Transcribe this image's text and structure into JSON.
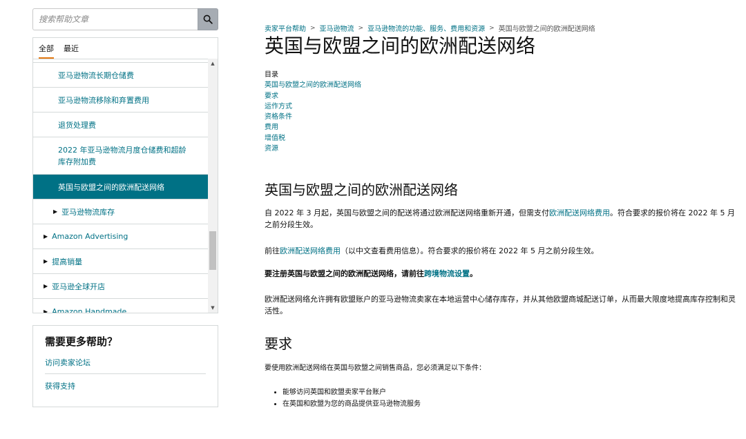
{
  "sidebar": {
    "search_placeholder": "搜索帮助文章",
    "tabs": [
      {
        "label": "全部",
        "active": true
      },
      {
        "label": "最近",
        "active": false
      }
    ],
    "nav_items": [
      {
        "label": "亚马逊物流长期仓储费",
        "level": 2,
        "selected": false
      },
      {
        "label": "亚马逊物流移除和弃置费用",
        "level": 2,
        "selected": false
      },
      {
        "label": "退货处理费",
        "level": 2,
        "selected": false
      },
      {
        "label": "2022 年亚马逊物流月度仓储费和超龄库存附加费",
        "level": 2,
        "selected": false
      },
      {
        "label": "英国与欧盟之间的欧洲配送网络",
        "level": 2,
        "selected": true
      },
      {
        "label": "亚马逊物流库存",
        "level": 2,
        "selected": false,
        "bullet": true
      },
      {
        "label": "Amazon Advertising",
        "level": 1,
        "bullet": true
      },
      {
        "label": "提高销量",
        "level": 1,
        "bullet": true
      },
      {
        "label": "亚马逊全球开店",
        "level": 1,
        "bullet": true
      },
      {
        "label": "Amazon Handmade",
        "level": 1,
        "bullet": true
      }
    ],
    "help": {
      "title": "需要更多帮助？",
      "links": [
        "访问卖家论坛",
        "获得支持"
      ]
    }
  },
  "main": {
    "breadcrumb": [
      "卖家平台帮助",
      "亚马逊物流",
      "亚马逊物流的功能、服务、费用和资源",
      "英国与欧盟之间的欧洲配送网络"
    ],
    "title": "英国与欧盟之间的欧洲配送网络",
    "toc_heading": "目录",
    "toc": [
      "英国与欧盟之间的欧洲配送网络",
      "要求",
      "运作方式",
      "资格条件",
      "费用",
      "增值税",
      "资源"
    ],
    "section1": {
      "heading": "英国与欧盟之间的欧洲配送网络",
      "p1_a": "自 2022 年 3 月起，英国与欧盟之间的配送将通过欧洲配送网络重新开通，但需支付",
      "p1_link": "欧洲配送网络费用",
      "p1_b": "。符合要求的报价将在 2022 年 5 月之前分段生效。",
      "p2_a": "前往",
      "p2_link": "欧洲配送网络费用",
      "p2_b": "（以中文查看费用信息）。符合要求的报价将在 2022 年 5 月之前分段生效。",
      "p3_a": "要注册英国与欧盟之间的欧洲配送网络，请前往",
      "p3_link": "跨境物流设置",
      "p3_b": "。",
      "p4": "欧洲配送网络允许拥有欧盟账户的亚马逊物流卖家在本地运营中心储存库存，并从其他欧盟商城配送订单，从而最大限度地提高库存控制和灵活性。"
    },
    "section2": {
      "heading": "要求",
      "intro": "要使用欧洲配送网络在英国与欧盟之间销售商品，您必须满足以下条件：",
      "bullets": [
        "能够访问英国和欧盟卖家平台账户",
        "在英国和欧盟为您的商品提供亚马逊物流服务"
      ]
    }
  }
}
